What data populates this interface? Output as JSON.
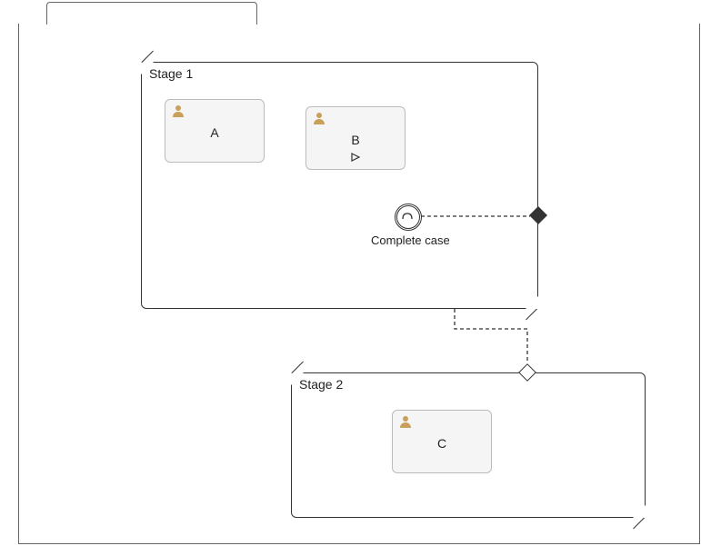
{
  "diagram": {
    "casePlan": {
      "tabLabel": ""
    },
    "stages": [
      {
        "id": "stage1",
        "label": "Stage 1"
      },
      {
        "id": "stage2",
        "label": "Stage 2"
      }
    ],
    "tasks": [
      {
        "id": "taskA",
        "label": "A",
        "stage": "stage1",
        "manual": false
      },
      {
        "id": "taskB",
        "label": "B",
        "stage": "stage1",
        "manual": true
      },
      {
        "id": "taskC",
        "label": "C",
        "stage": "stage2",
        "manual": false
      }
    ],
    "milestones": [
      {
        "id": "m1",
        "label": "Complete case"
      }
    ],
    "sentries": [
      {
        "id": "s1",
        "type": "exit",
        "filled": true,
        "attachedTo": "stage1"
      },
      {
        "id": "s2",
        "type": "entry",
        "filled": false,
        "attachedTo": "stage2"
      }
    ],
    "connectors": [
      {
        "from": "m1",
        "to": "s1",
        "style": "dashed"
      },
      {
        "from": "stage1",
        "to": "s2",
        "style": "dashed"
      }
    ]
  },
  "icons": {
    "person": "person-icon",
    "manual": "manual-activation-marker"
  },
  "colors": {
    "iconAccent": "#c9a05a",
    "taskFill": "#f5f5f5",
    "border": "#333333"
  }
}
